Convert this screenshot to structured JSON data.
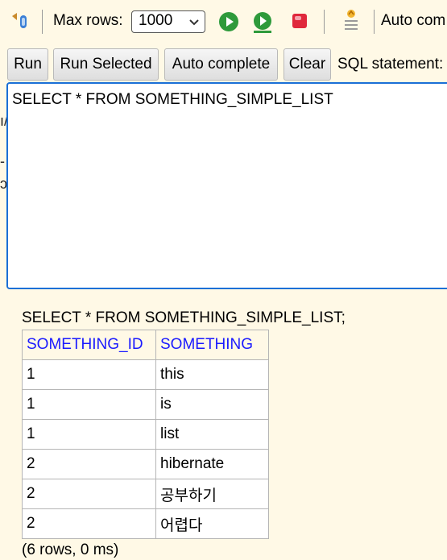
{
  "toolbar": {
    "max_rows_label": "Max rows:",
    "max_rows_value": "1000",
    "auto_commit_label": "Auto com",
    "icons": [
      "refresh-icon",
      "run-icon",
      "run-selected-icon",
      "stop-icon",
      "history-icon"
    ]
  },
  "buttons": {
    "run": "Run",
    "run_selected": "Run Selected",
    "auto_complete": "Auto complete",
    "clear": "Clear",
    "sql_statement_label": "SQL statement:"
  },
  "editor": {
    "sql": "SELECT * FROM SOMETHING_SIMPLE_LIST"
  },
  "results": {
    "query": "SELECT * FROM SOMETHING_SIMPLE_LIST;",
    "columns": [
      "SOMETHING_ID",
      "SOMETHING"
    ],
    "rows": [
      [
        "1",
        "this"
      ],
      [
        "1",
        "is"
      ],
      [
        "1",
        "list"
      ],
      [
        "2",
        "hibernate"
      ],
      [
        "2",
        "공부하기"
      ],
      [
        "2",
        "어렵다"
      ]
    ],
    "summary": "(6 rows, 0 ms)"
  },
  "colors": {
    "background": "#FFF9E6",
    "editor_border": "#1a6fd6",
    "header_text": "#1a1aff",
    "run_green": "#2e9a3b",
    "stop_red": "#e0283c"
  }
}
